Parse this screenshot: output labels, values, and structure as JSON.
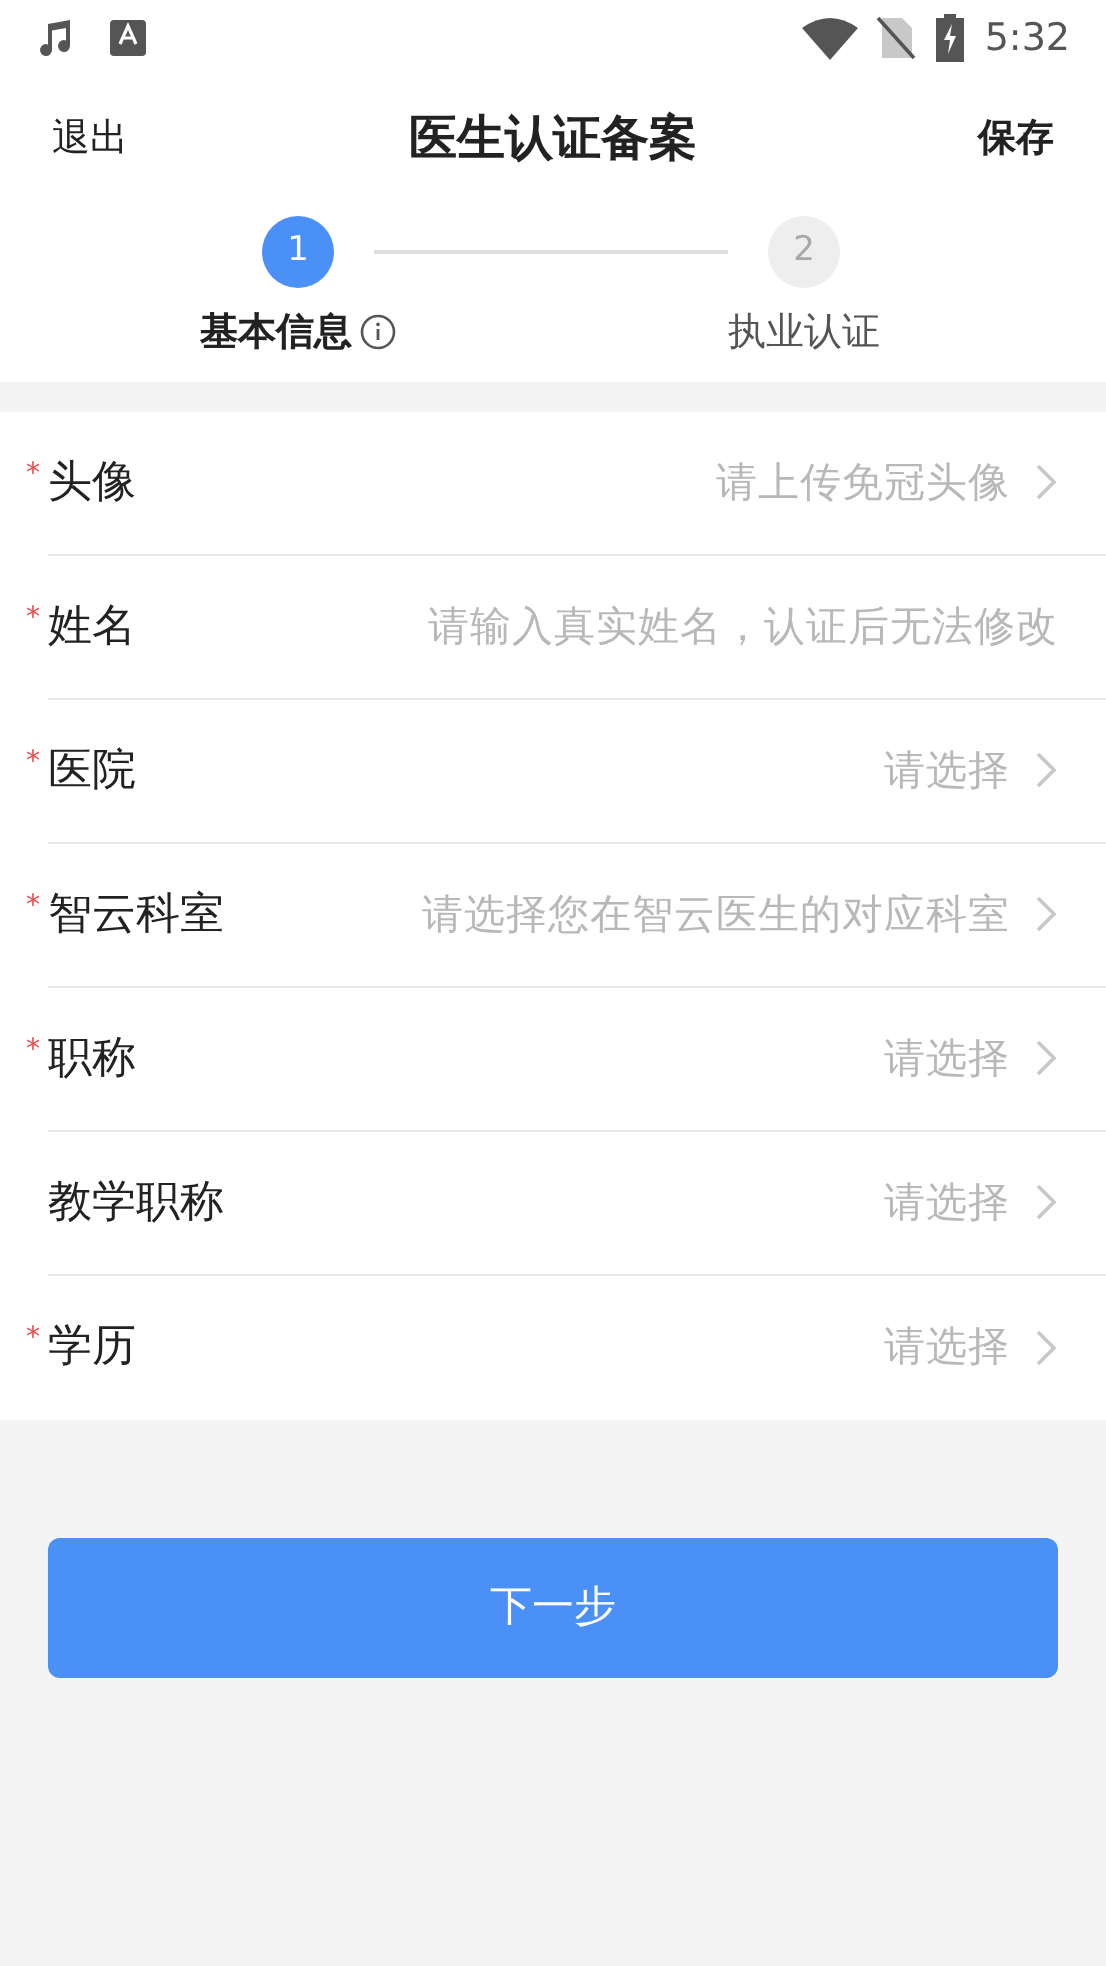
{
  "status_bar": {
    "time": "5:32"
  },
  "header": {
    "left": "退出",
    "title": "医生认证备案",
    "right": "保存"
  },
  "steps": [
    {
      "number": "1",
      "label": "基本信息",
      "selected": true,
      "info": true
    },
    {
      "number": "2",
      "label": "执业认证",
      "selected": false
    }
  ],
  "fields": [
    {
      "label": "头像",
      "mark": "*",
      "kind": "select",
      "placeholder": "请上传免冠头像"
    },
    {
      "label": "姓名",
      "mark": "*",
      "kind": "input",
      "placeholder": "请输入真实姓名，认证后无法修改"
    },
    {
      "label": "医院",
      "mark": "*",
      "kind": "select",
      "placeholder": "请选择"
    },
    {
      "label": "智云科室",
      "mark": "*",
      "kind": "select",
      "placeholder": "请选择您在智云医生的对应科室"
    },
    {
      "label": "职称",
      "mark": "*",
      "kind": "select",
      "placeholder": "请选择"
    },
    {
      "label": "教学职称",
      "kind": "select",
      "placeholder": "请选择"
    },
    {
      "label": "学历",
      "mark": "*",
      "kind": "select",
      "placeholder": "请选择"
    }
  ],
  "next_button": "下一步"
}
